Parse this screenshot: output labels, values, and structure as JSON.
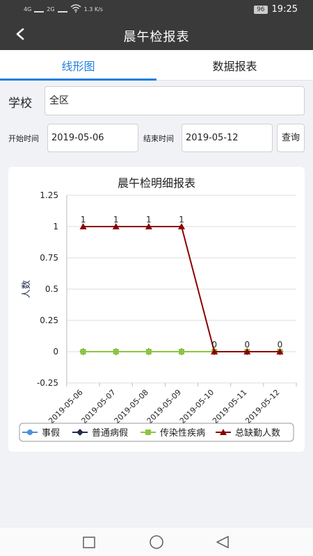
{
  "status": {
    "network": "4G",
    "network2": "2G",
    "speed": "1.3 K/s",
    "battery": "96",
    "time": "19:25"
  },
  "appbar": {
    "title": "晨午检报表"
  },
  "tabs": [
    {
      "label": "线形图",
      "active": true
    },
    {
      "label": "数据报表",
      "active": false
    }
  ],
  "filters": {
    "school_label": "学校",
    "school_value": "全区",
    "start_label": "开始时间",
    "start_value": "2019-05-06",
    "end_label": "结束时间",
    "end_value": "2019-05-12",
    "query_label": "查询"
  },
  "chart_data": {
    "type": "line",
    "title": "晨午检明细报表",
    "ylabel": "人数",
    "xlabel": "",
    "ylim": [
      -0.25,
      1.25
    ],
    "yticks": [
      -0.25,
      0,
      0.25,
      0.5,
      0.75,
      1,
      1.25
    ],
    "categories": [
      "2019-05-06",
      "2019-05-07",
      "2019-05-08",
      "2019-05-09",
      "2019-05-10",
      "2019-05-11",
      "2019-05-12"
    ],
    "series": [
      {
        "name": "事假",
        "values": [
          0,
          0,
          0,
          0,
          0,
          0,
          0
        ],
        "color": "#4a90d9",
        "marker": "circle"
      },
      {
        "name": "普通病假",
        "values": [
          0,
          0,
          0,
          0,
          0,
          0,
          0
        ],
        "color": "#1f2d4a",
        "marker": "diamond"
      },
      {
        "name": "传染性疾病",
        "values": [
          0,
          0,
          0,
          0,
          0,
          0,
          0
        ],
        "color": "#8cc63f",
        "marker": "square"
      },
      {
        "name": "总缺勤人数",
        "values": [
          1,
          1,
          1,
          1,
          0,
          0,
          0
        ],
        "color": "#8b0000",
        "marker": "triangle"
      }
    ],
    "data_labels": [
      "1",
      "1",
      "1",
      "1",
      "0",
      "0",
      "0"
    ],
    "legend": "bottom",
    "grid": true
  }
}
